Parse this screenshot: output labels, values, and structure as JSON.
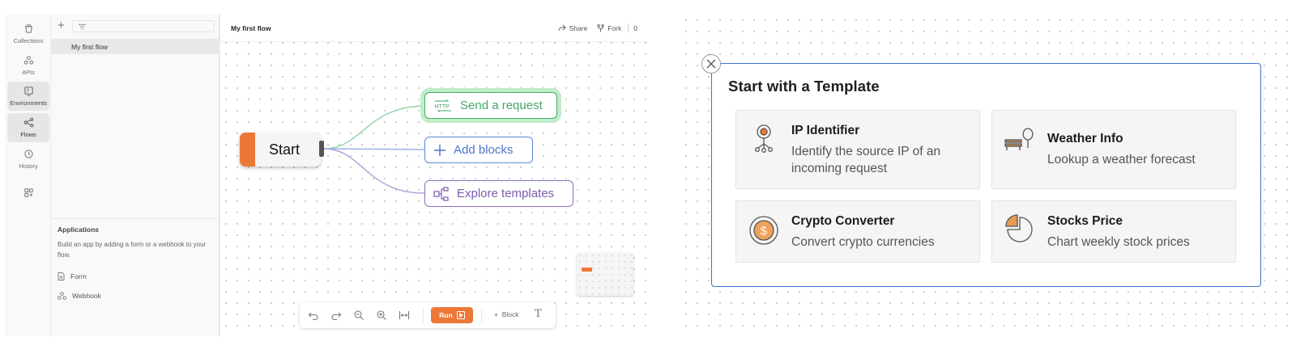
{
  "rail": {
    "items": [
      {
        "label": "Collections",
        "icon": "collections-icon"
      },
      {
        "label": "APIs",
        "icon": "apis-icon"
      },
      {
        "label": "Environments",
        "icon": "environments-icon"
      },
      {
        "label": "Flows",
        "icon": "flows-icon",
        "active": true
      },
      {
        "label": "History",
        "icon": "history-icon"
      }
    ]
  },
  "sidebar": {
    "flow_item": "My first flow",
    "applications": {
      "title": "Applications",
      "description": "Build an app by adding a form or a webhook to your flow.",
      "items": [
        {
          "label": "Form",
          "icon": "form-icon"
        },
        {
          "label": "Webhook",
          "icon": "webhook-icon"
        }
      ]
    }
  },
  "canvas": {
    "title": "My first flow",
    "share_label": "Share",
    "fork_label": "Fork",
    "fork_count": "0",
    "start_label": "Start",
    "nodes": {
      "send": {
        "label": "Send a request",
        "icon": "http-icon"
      },
      "add": {
        "label": "Add blocks",
        "icon": "plus-icon"
      },
      "explore": {
        "label": "Explore templates",
        "icon": "templates-icon"
      }
    },
    "toolbar": {
      "run_label": "Run",
      "block_label": "Block",
      "text_label": "T"
    },
    "colors": {
      "accent": "#ed7737",
      "send": "#47a56a",
      "add": "#4a76c9",
      "explore": "#7d5aae"
    }
  },
  "templates": {
    "title": "Start with a Template",
    "cards": [
      {
        "title": "IP Identifier",
        "description": "Identify the source IP of an incoming request",
        "icon": "ip-location-icon"
      },
      {
        "title": "Weather Info",
        "description": "Lookup a weather forecast",
        "icon": "park-bench-tree-icon"
      },
      {
        "title": "Crypto Converter",
        "description": "Convert crypto currencies",
        "icon": "dollar-coin-icon"
      },
      {
        "title": "Stocks Price",
        "description": "Chart weekly stock prices",
        "icon": "pie-chart-icon"
      }
    ],
    "border_color": "#3b74d4"
  }
}
